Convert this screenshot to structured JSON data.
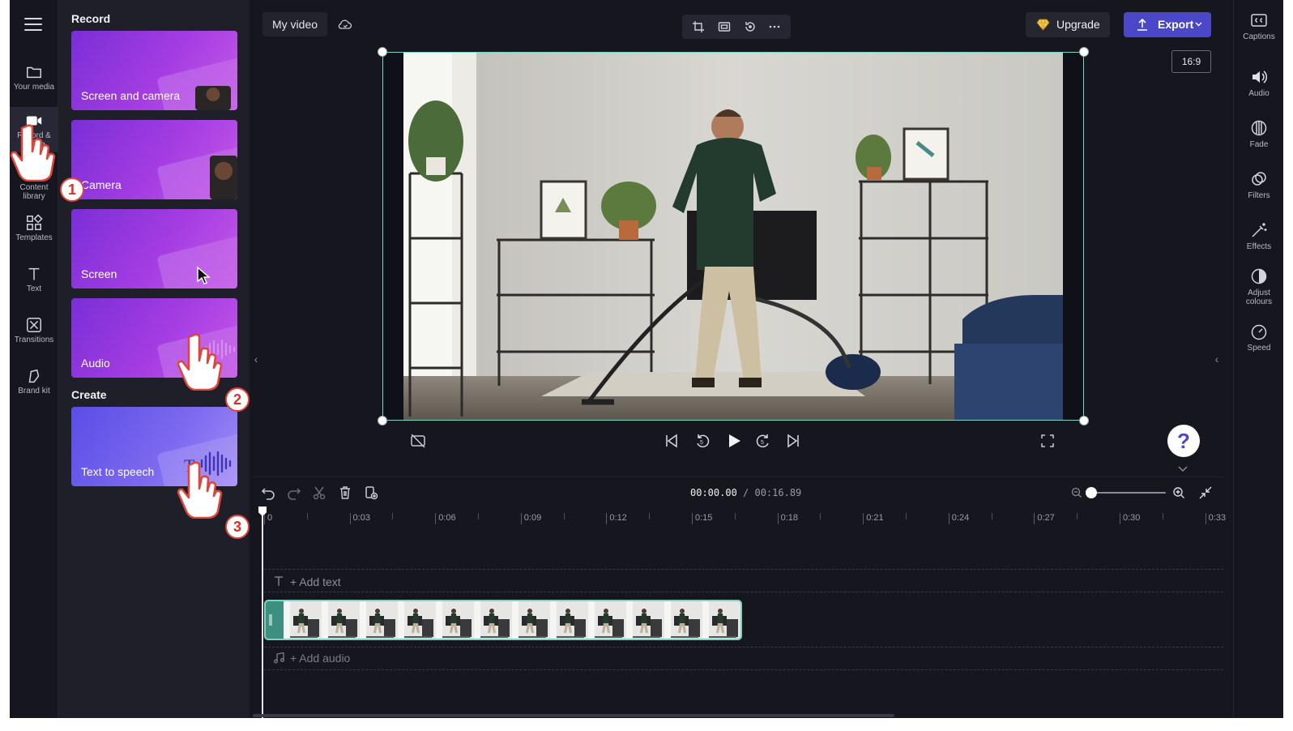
{
  "project": {
    "name": "My video"
  },
  "left_rail": {
    "items": [
      {
        "label": "Your media",
        "icon": "folder-icon"
      },
      {
        "label": "Record & create",
        "icon": "video-camera-icon"
      },
      {
        "label": "Content library",
        "icon": "library-icon"
      },
      {
        "label": "Templates",
        "icon": "templates-icon"
      },
      {
        "label": "Text",
        "icon": "text-icon"
      },
      {
        "label": "Transitions",
        "icon": "transitions-icon"
      },
      {
        "label": "Brand kit",
        "icon": "brand-kit-icon"
      }
    ]
  },
  "panel": {
    "record_title": "Record",
    "create_title": "Create",
    "cards": [
      {
        "label": "Screen and camera"
      },
      {
        "label": "Camera"
      },
      {
        "label": "Screen"
      },
      {
        "label": "Audio"
      },
      {
        "label": "Text to speech"
      }
    ]
  },
  "callouts": [
    "1",
    "2",
    "3"
  ],
  "toolbar": {
    "upgrade_label": "Upgrade",
    "export_label": "Export",
    "aspect_ratio": "16:9"
  },
  "timeline": {
    "current_time": "00:00.00",
    "separator": " / ",
    "total_time": "00:16.89",
    "ruler_labels": [
      "0",
      "0:03",
      "0:06",
      "0:09",
      "0:12",
      "0:15",
      "0:18",
      "0:21",
      "0:24",
      "0:27",
      "0:30",
      "0:33"
    ],
    "add_text_label": "+ Add text",
    "add_audio_label": "+ Add audio"
  },
  "right_rail": {
    "items": [
      {
        "label": "Captions",
        "icon": "captions-icon"
      },
      {
        "label": "Audio",
        "icon": "speaker-icon"
      },
      {
        "label": "Fade",
        "icon": "fade-icon"
      },
      {
        "label": "Filters",
        "icon": "filters-icon"
      },
      {
        "label": "Effects",
        "icon": "magic-wand-icon"
      },
      {
        "label": "Adjust colours",
        "icon": "adjust-colours-icon"
      },
      {
        "label": "Speed",
        "icon": "speedometer-icon"
      }
    ]
  },
  "colors": {
    "accent": "#4a48c8",
    "selection": "#7fd3c2",
    "background": "#16161e",
    "panel": "#1f1f29",
    "badge_ring": "#e0443a"
  }
}
